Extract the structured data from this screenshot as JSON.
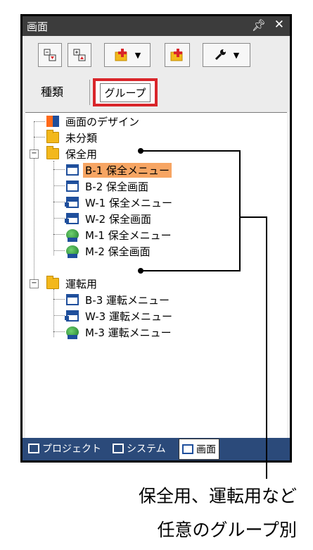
{
  "panel": {
    "title": "画面",
    "pin_icon": "pin-icon",
    "close_icon": "close-icon"
  },
  "toolbar": {
    "buttons": [
      {
        "name": "expand-tree-button",
        "icon": "expand-icon"
      },
      {
        "name": "collapse-tree-button",
        "icon": "collapse-icon"
      },
      {
        "name": "add-screen-button",
        "icon": "add-folder-icon",
        "dropdown": "▼"
      },
      {
        "name": "add-group-button",
        "icon": "add-folder-icon"
      },
      {
        "name": "tools-button",
        "icon": "wrench-icon",
        "dropdown": "▼"
      }
    ]
  },
  "view_tabs": {
    "type_label": "種類",
    "group_label": "グループ"
  },
  "tree": {
    "nodes": [
      {
        "label": "画面のデザイン",
        "icon": "design-icon"
      },
      {
        "label": "未分類",
        "icon": "folder-icon"
      },
      {
        "label": "保全用",
        "icon": "folder-icon",
        "expander": "−"
      },
      {
        "label": "B-1 保全メニュー",
        "icon": "window-icon",
        "selected": true
      },
      {
        "label": "B-2 保全画面",
        "icon": "window-icon"
      },
      {
        "label": "W-1 保全メニュー",
        "icon": "web-window-icon"
      },
      {
        "label": "W-2 保全画面",
        "icon": "web-window-icon"
      },
      {
        "label": "M-1 保全メニュー",
        "icon": "mobile-globe-icon"
      },
      {
        "label": "M-2 保全画面",
        "icon": "mobile-globe-icon"
      },
      {
        "label": "運転用",
        "icon": "folder-icon",
        "expander": "−"
      },
      {
        "label": "B-3 運転メニュー",
        "icon": "window-icon"
      },
      {
        "label": "W-3 運転メニュー",
        "icon": "web-window-icon"
      },
      {
        "label": "M-3 運転メニュー",
        "icon": "mobile-globe-icon"
      }
    ]
  },
  "bottom_tabs": [
    {
      "label": "プロジェクト",
      "icon": "project-icon"
    },
    {
      "label": "システム",
      "icon": "system-icon"
    },
    {
      "label": "画面",
      "icon": "screen-icon",
      "active": true
    }
  ],
  "caption": {
    "line1": "保全用、運転用など",
    "line2": "任意のグループ別"
  },
  "colors": {
    "selected_bg": "#f7a563",
    "highlight_border": "#d9262b",
    "title_bg": "#3c3c3c",
    "bottom_bar_bg": "#2b4a7a"
  }
}
